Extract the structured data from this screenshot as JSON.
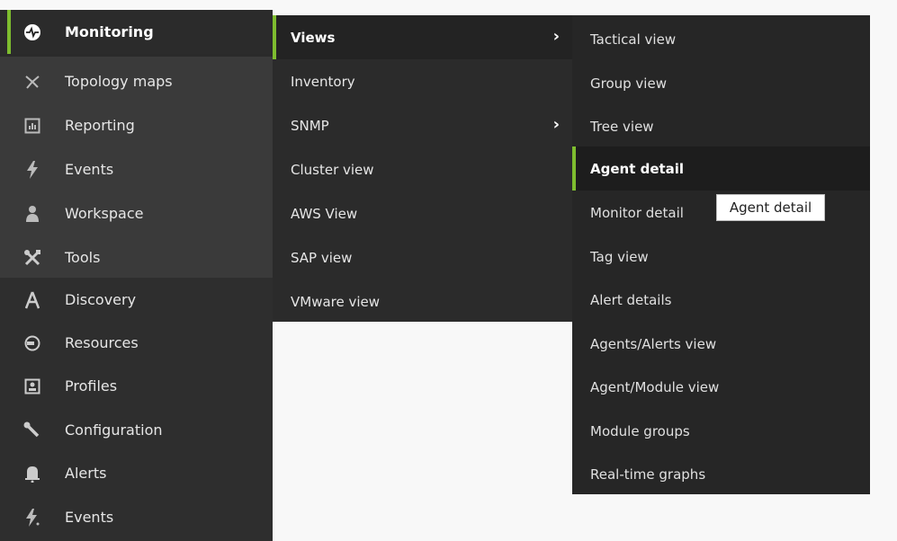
{
  "main_menu": [
    {
      "label": "Monitoring",
      "icon": "heartbeat-icon",
      "active": true
    },
    {
      "label": "Topology maps",
      "icon": "topology-icon"
    },
    {
      "label": "Reporting",
      "icon": "report-icon"
    },
    {
      "label": "Events",
      "icon": "lightning-icon"
    },
    {
      "label": "Workspace",
      "icon": "user-icon"
    },
    {
      "label": "Tools",
      "icon": "tools-icon"
    },
    {
      "label": "Discovery",
      "icon": "discovery-icon"
    },
    {
      "label": "Resources",
      "icon": "resources-icon"
    },
    {
      "label": "Profiles",
      "icon": "profile-icon"
    },
    {
      "label": "Configuration",
      "icon": "wrench-icon"
    },
    {
      "label": "Alerts",
      "icon": "bell-icon"
    },
    {
      "label": "Events",
      "icon": "lightning-icon"
    }
  ],
  "views_menu": [
    {
      "label": "Views",
      "has_submenu": true,
      "active": true
    },
    {
      "label": "Inventory"
    },
    {
      "label": "SNMP",
      "has_submenu": true
    },
    {
      "label": "Cluster view"
    },
    {
      "label": "AWS View"
    },
    {
      "label": "SAP view"
    },
    {
      "label": "VMware view"
    }
  ],
  "views_submenu": [
    {
      "label": "Tactical view"
    },
    {
      "label": "Group view"
    },
    {
      "label": "Tree view"
    },
    {
      "label": "Agent detail",
      "active": true
    },
    {
      "label": "Monitor detail"
    },
    {
      "label": "Tag view"
    },
    {
      "label": "Alert details"
    },
    {
      "label": "Agents/Alerts view"
    },
    {
      "label": "Agent/Module view"
    },
    {
      "label": "Module groups"
    },
    {
      "label": "Real-time graphs"
    }
  ],
  "tooltip": {
    "text": "Agent detail"
  },
  "colors": {
    "accent": "#7ebd2f"
  }
}
